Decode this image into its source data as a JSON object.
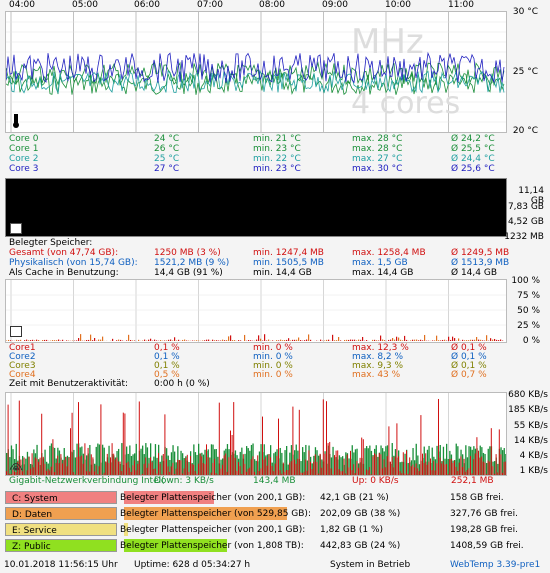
{
  "hours": [
    "04:00",
    "05:00",
    "06:00",
    "07:00",
    "08:00",
    "09:00",
    "10:00",
    "11:00"
  ],
  "temp": {
    "y_labels": [
      "30 °C",
      "25 °C",
      "20 °C"
    ],
    "watermark": {
      "mhz": "MHz",
      "cores": "4 cores"
    },
    "rows": [
      {
        "name": "Core 0",
        "cur": "24 °C",
        "min": "min. 21 °C",
        "max": "max. 28 °C",
        "avg": "Ø 24,2 °C",
        "color": "#1a8f3a"
      },
      {
        "name": "Core 1",
        "cur": "26 °C",
        "min": "min. 23 °C",
        "max": "max. 28 °C",
        "avg": "Ø 25,5 °C",
        "color": "#1a8f3a"
      },
      {
        "name": "Core 2",
        "cur": "25 °C",
        "min": "min. 22 °C",
        "max": "max. 27 °C",
        "avg": "Ø 24,4 °C",
        "color": "#20a0a0"
      },
      {
        "name": "Core 3",
        "cur": "27 °C",
        "min": "min. 23 °C",
        "max": "max. 30 °C",
        "avg": "Ø 25,6 °C",
        "color": "#2020c0"
      }
    ]
  },
  "mem": {
    "y_labels": [
      "11,14 GB",
      "7,83 GB",
      "4,52 GB",
      "1232 MB"
    ],
    "title": "Belegter Speicher:",
    "rows": [
      {
        "name": "Gesamt (von 47,74 GB):",
        "cur": "1250 MB (3 %)",
        "min": "min. 1247,4 MB",
        "max": "max. 1258,4 MB",
        "avg": "Ø 1249,5 MB",
        "color": "#d01010"
      },
      {
        "name": "Physikalisch (von 15,74 GB):",
        "cur": "1521,2 MB (9 %)",
        "min": "min. 1505,5 MB",
        "max": "max. 1,5 GB",
        "avg": "Ø 1513,9 MB",
        "color": "#1060c0"
      },
      {
        "name": "Als Cache in Benutzung:",
        "cur": "14,4 GB (91 %)",
        "min": "min. 14,4 GB",
        "max": "max. 14,4 GB",
        "avg": "Ø 14,4 GB",
        "color": "#000000"
      }
    ]
  },
  "cpu": {
    "y_labels": [
      "100 %",
      "75 %",
      "50 %",
      "25 %",
      "0 %"
    ],
    "rows": [
      {
        "name": "Core1",
        "cur": "0,1 %",
        "min": "min. 0 %",
        "max": "max. 12,3 %",
        "avg": "Ø 0,1 %",
        "color": "#d01010"
      },
      {
        "name": "Core2",
        "cur": "0,1 %",
        "min": "min. 0 %",
        "max": "max. 8,2 %",
        "avg": "Ø 0,1 %",
        "color": "#1060c0"
      },
      {
        "name": "Core3",
        "cur": "0,1 %",
        "min": "min. 0 %",
        "max": "max. 9,3 %",
        "avg": "Ø 0,1 %",
        "color": "#808000"
      },
      {
        "name": "Core4",
        "cur": "0,5 %",
        "min": "min. 0 %",
        "max": "max. 43 %",
        "avg": "Ø 0,7 %",
        "color": "#e07020"
      }
    ],
    "activity_label": "Zeit mit Benutzeraktivität:",
    "activity_value": "0:00 h (0 %)"
  },
  "net": {
    "y_labels": [
      "680 KB/s",
      "185 KB/s",
      "55 KB/s",
      "14 KB/s",
      "4 KB/s",
      "1 KB/s"
    ],
    "label": "Gigabit-Netzwerkverbindung Intel(",
    "down": "Down: 3 KB/s",
    "down_total": "143,4 MB",
    "up": "Up: 0 KB/s",
    "up_total": "252,1 MB"
  },
  "drives": [
    {
      "name": "C: System",
      "label": "Belegter Plattenspeicher (von 200,1 GB):",
      "used": "42,1 GB (21 %)",
      "free": "158 GB frei.",
      "color": "#f08080",
      "bar": 0.21
    },
    {
      "name": "D: Daten",
      "label": "Belegter Plattenspeicher (von 529,85 GB):",
      "used": "202,09 GB (38 %)",
      "free": "327,76 GB frei.",
      "color": "#f0a050",
      "bar": 0.38
    },
    {
      "name": "E: Service",
      "label": "Belegter Plattenspeicher (von 200,1 GB):",
      "used": "1,82 GB (1 %)",
      "free": "198,28 GB frei.",
      "color": "#f0e080",
      "bar": 0.01
    },
    {
      "name": "Z: Public",
      "label": "Belegter Plattenspeicher (von 1,808 TB):",
      "used": "442,83 GB (24 %)",
      "free": "1408,59 GB frei.",
      "color": "#90e020",
      "bar": 0.24
    }
  ],
  "footer": {
    "datetime": "10.01.2018 11:56:15 Uhr",
    "uptime": "Uptime: 628 d 05:34:27 h",
    "status": "System in Betrieb",
    "version": "WebTemp 3.39-pre1"
  }
}
